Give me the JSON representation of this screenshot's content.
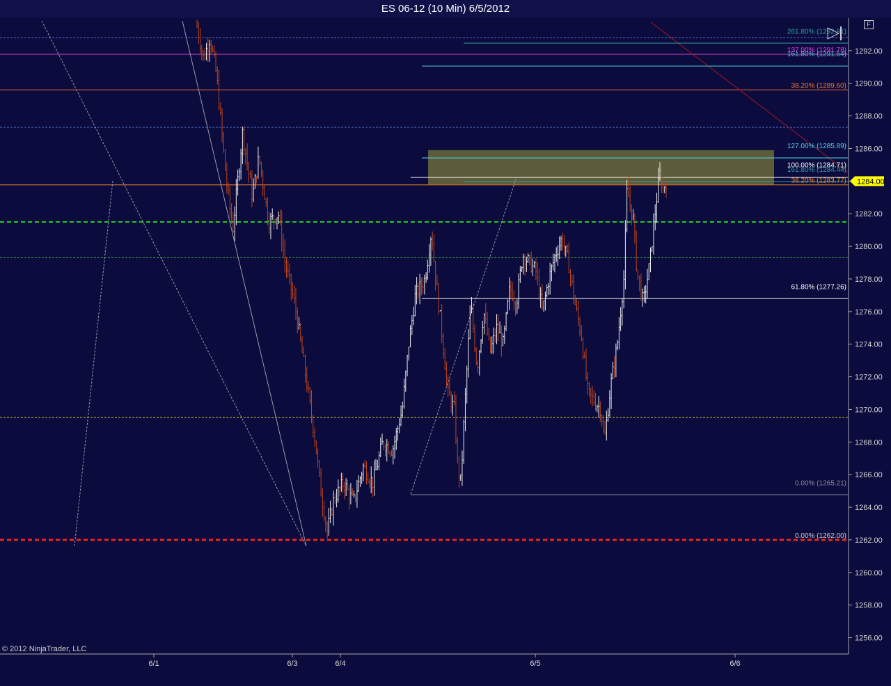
{
  "title": "ES 06-12 (10 Min)  6/5/2012",
  "copyright": "© 2012 NinjaTrader, LLC",
  "panel_button": "F",
  "colors": {
    "background": "#0b0b3d",
    "axis_text": "#d8d8d8",
    "price_marker": "#ffff00",
    "up_bar": "#f0f0f0",
    "down_bar": "#c0461c"
  },
  "chart_data": {
    "type": "bar",
    "instrument": "ES 06-12",
    "interval": "10 Min",
    "ylim": [
      1255,
      1294
    ],
    "y_ticks": [
      1256,
      1258,
      1260,
      1262,
      1264,
      1266,
      1268,
      1270,
      1272,
      1274,
      1276,
      1278,
      1280,
      1282,
      1284,
      1286,
      1288,
      1290,
      1292
    ],
    "x_tick_labels": [
      "6/1",
      "6/3",
      "6/4",
      "6/5",
      "6/6"
    ],
    "last_price": "1284.00",
    "last_price_value": 1284.0,
    "price_path": [
      [
        0.0,
        1293.5
      ],
      [
        0.02,
        1291.5
      ],
      [
        0.04,
        1292.8
      ],
      [
        0.06,
        1290.5
      ],
      [
        0.09,
        1284.0
      ],
      [
        0.11,
        1281.0
      ],
      [
        0.14,
        1287.0
      ],
      [
        0.17,
        1283.0
      ],
      [
        0.19,
        1285.5
      ],
      [
        0.22,
        1281.5
      ],
      [
        0.25,
        1282.0
      ],
      [
        0.27,
        1279.0
      ],
      [
        0.3,
        1276.5
      ],
      [
        0.33,
        1272.5
      ],
      [
        0.36,
        1268.5
      ],
      [
        0.38,
        1265.0
      ],
      [
        0.4,
        1262.5
      ],
      [
        0.42,
        1264.5
      ],
      [
        0.45,
        1265.5
      ],
      [
        0.48,
        1264.3
      ],
      [
        0.51,
        1266.5
      ],
      [
        0.54,
        1265.5
      ],
      [
        0.57,
        1268.0
      ],
      [
        0.6,
        1267.5
      ],
      [
        0.63,
        1270.0
      ],
      [
        0.65,
        1274.0
      ],
      [
        0.67,
        1277.0
      ],
      [
        0.7,
        1278.0
      ],
      [
        0.72,
        1281.0
      ],
      [
        0.73,
        1278.5
      ],
      [
        0.75,
        1275.0
      ],
      [
        0.77,
        1271.0
      ],
      [
        0.79,
        1270.0
      ],
      [
        0.8,
        1266.5
      ],
      [
        0.81,
        1265.5
      ],
      [
        0.82,
        1269.5
      ],
      [
        0.84,
        1276.5
      ],
      [
        0.86,
        1272.5
      ],
      [
        0.88,
        1276.0
      ],
      [
        0.9,
        1273.5
      ],
      [
        0.92,
        1275.0
      ],
      [
        0.94,
        1274.0
      ],
      [
        0.96,
        1277.5
      ],
      [
        0.98,
        1276.5
      ],
      [
        1.0,
        1279.5
      ],
      [
        1.02,
        1279.0
      ],
      [
        1.04,
        1278.5
      ],
      [
        1.06,
        1276.0
      ],
      [
        1.08,
        1278.0
      ],
      [
        1.1,
        1279.5
      ],
      [
        1.12,
        1280.5
      ],
      [
        1.14,
        1279.0
      ],
      [
        1.16,
        1276.5
      ],
      [
        1.18,
        1274.5
      ],
      [
        1.2,
        1271.0
      ],
      [
        1.22,
        1270.5
      ],
      [
        1.24,
        1270.0
      ],
      [
        1.25,
        1268.0
      ],
      [
        1.27,
        1271.5
      ],
      [
        1.29,
        1274.0
      ],
      [
        1.31,
        1278.0
      ],
      [
        1.32,
        1283.5
      ],
      [
        1.34,
        1281.5
      ],
      [
        1.35,
        1278.5
      ],
      [
        1.37,
        1276.5
      ],
      [
        1.39,
        1279.0
      ],
      [
        1.4,
        1281.0
      ],
      [
        1.42,
        1284.5
      ],
      [
        1.43,
        1283.5
      ],
      [
        1.44,
        1284.0
      ]
    ],
    "horizontal_levels": [
      {
        "value": 1292.8,
        "style": "dashed",
        "color": "#4f6fcf"
      },
      {
        "value": 1291.78,
        "style": "solid",
        "color": "#cc44cc"
      },
      {
        "value": 1289.6,
        "style": "solid",
        "color": "#e0602a"
      },
      {
        "value": 1287.3,
        "style": "dashed",
        "color": "#4f6fcf"
      },
      {
        "value": 1283.77,
        "style": "solid",
        "color": "#ff8a1e"
      },
      {
        "value": 1281.5,
        "style": "thick-dashed",
        "color": "#22cc22"
      },
      {
        "value": 1279.3,
        "style": "dashed",
        "color": "#33aa33"
      },
      {
        "value": 1269.5,
        "style": "dashed",
        "color": "#d8c828"
      },
      {
        "value": 1262.0,
        "style": "thick-dashed",
        "color": "#ee2222"
      }
    ],
    "fib_labels": [
      {
        "text": "261.80% (1292.91)",
        "value": 1292.91,
        "color": "#2f9f9f"
      },
      {
        "text": "137.00% (1291.78)",
        "value": 1291.78,
        "color": "#ff33ff"
      },
      {
        "text": "161.80% (1291.54)",
        "value": 1291.54,
        "color": "#4fc8d8"
      },
      {
        "text": "38.20% (1289.60)",
        "value": 1289.6,
        "color": "#f07a2a"
      },
      {
        "text": "127.00% (1285.89)",
        "value": 1285.89,
        "color": "#4fd8e8"
      },
      {
        "text": "100.00% (1284.71)",
        "value": 1284.71,
        "color": "#ffffff"
      },
      {
        "text": "161.80% (1284.44)",
        "value": 1284.44,
        "color": "#2f9f9f"
      },
      {
        "text": "38.20% (1283.77)",
        "value": 1283.77,
        "color": "#ff8a1e"
      },
      {
        "text": "61.80% (1277.26)",
        "value": 1277.26,
        "color": "#ffffff"
      },
      {
        "text": "0.00% (1265.21)",
        "value": 1265.21,
        "color": "#8a8a9a"
      },
      {
        "text": "0.00% (1262.00)",
        "value": 1262.0,
        "color": "#d0d0d0"
      }
    ],
    "zone": {
      "from": 1283.8,
      "to": 1285.9,
      "color": "#6b6a3a"
    }
  }
}
